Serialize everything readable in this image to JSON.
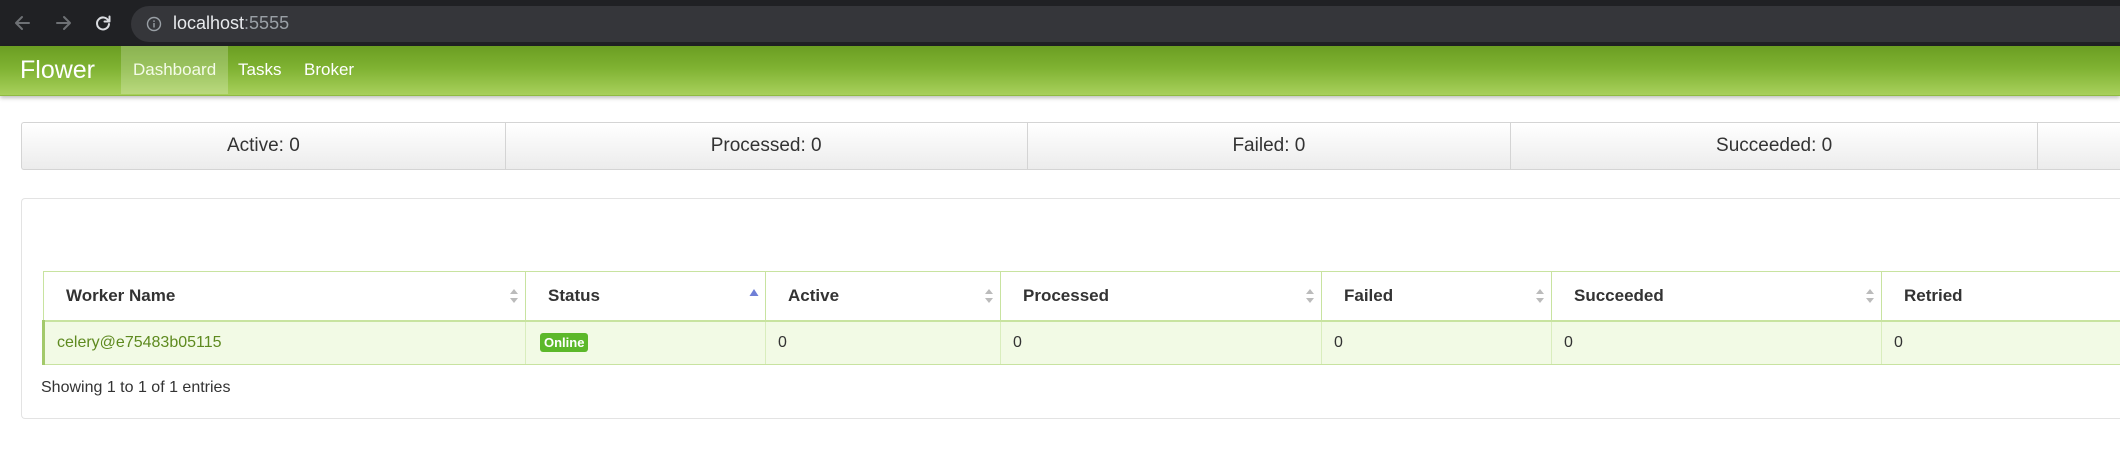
{
  "browser": {
    "url_host": "localhost",
    "url_port": ":5555"
  },
  "app": {
    "brand": "Flower",
    "nav": [
      {
        "label": "Dashboard",
        "active": true
      },
      {
        "label": "Tasks",
        "active": false
      },
      {
        "label": "Broker",
        "active": false
      }
    ]
  },
  "summary": [
    {
      "label": "Active: 0"
    },
    {
      "label": "Processed: 0"
    },
    {
      "label": "Failed: 0"
    },
    {
      "label": "Succeeded: 0"
    }
  ],
  "workers_table": {
    "columns": [
      {
        "label": "Worker Name",
        "sort": "none"
      },
      {
        "label": "Status",
        "sort": "ascending"
      },
      {
        "label": "Active",
        "sort": "none"
      },
      {
        "label": "Processed",
        "sort": "none"
      },
      {
        "label": "Failed",
        "sort": "none"
      },
      {
        "label": "Succeeded",
        "sort": "none"
      },
      {
        "label": "Retried",
        "sort": "none"
      }
    ],
    "rows": [
      {
        "worker_name": "celery@e75483b05115",
        "status": "Online",
        "active": "0",
        "processed": "0",
        "failed": "0",
        "succeeded": "0",
        "retried": "0"
      }
    ],
    "info": "Showing 1 to 1 of 1 entries"
  },
  "colors": {
    "navbar_green": "#7fb232",
    "link_green": "#5e8a1f",
    "badge_green": "#5cb82a",
    "row_highlight": "#f2fae5",
    "sort_active": "#6f7fd6",
    "sort_inactive": "#bbbbbb"
  }
}
